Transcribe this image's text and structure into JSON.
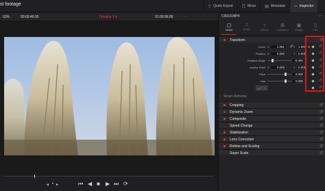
{
  "project_title": "st footage",
  "top_menu": [
    {
      "label": "Quick Export",
      "icon": "export-icon",
      "glyph": "⇪"
    },
    {
      "label": "Mixer",
      "icon": "mixer-icon",
      "glyph": "☷"
    },
    {
      "label": "Metadata",
      "icon": "metadata-icon",
      "glyph": "▤"
    },
    {
      "label": "Inspector",
      "icon": "inspector-icon",
      "glyph": "✂"
    }
  ],
  "viewer_header": {
    "zoom": "63%",
    "source_timecode": "00:00:46:30",
    "timeline_name": "Timeline 1 ▾",
    "record_timecode": "01:00:06;00",
    "options": "⋯"
  },
  "inspector": {
    "clip_name": "C0019.MP4",
    "menu": "⋯",
    "tabs": [
      {
        "label": "Video",
        "glyph": "▢",
        "active": true
      },
      {
        "label": "Audio",
        "glyph": "♫",
        "active": false
      },
      {
        "label": "Effects",
        "glyph": "✧",
        "active": false
      },
      {
        "label": "Transition",
        "glyph": "⊠",
        "active": false
      },
      {
        "label": "Image",
        "glyph": "▣",
        "active": false
      },
      {
        "label": "File",
        "glyph": "▯",
        "active": false
      }
    ],
    "transform": {
      "title": "Transform",
      "zoom": {
        "label": "Zoom",
        "x": "1.081",
        "y": "1.081"
      },
      "position": {
        "label": "Position",
        "x": "0.000",
        "y": "0.000"
      },
      "rotation": {
        "label": "Rotation Angle",
        "value": "-0.400"
      },
      "anchor": {
        "label": "Anchor Point",
        "x": "0.000",
        "y": "0.000"
      },
      "pitch": {
        "label": "Pitch",
        "value": "0.000"
      },
      "yaw": {
        "label": "Yaw",
        "value": "0.000"
      },
      "flip": {
        "label": "Flip",
        "h": "↔",
        "v": "↕"
      },
      "x_axis": "X",
      "y_axis": "Y"
    },
    "smart_reframe": "Smart Reframe",
    "sections": [
      {
        "label": "Cropping",
        "enabled": true
      },
      {
        "label": "Dynamic Zoom",
        "enabled": false
      },
      {
        "label": "Composite",
        "enabled": true
      },
      {
        "label": "Speed Change",
        "enabled": false
      },
      {
        "label": "Stabilization",
        "enabled": true
      },
      {
        "label": "Lens Correction",
        "enabled": true
      },
      {
        "label": "Retime and Scaling",
        "enabled": false
      },
      {
        "label": "Super Scale",
        "enabled": false
      }
    ],
    "reset_glyph": "↺"
  },
  "transport": {
    "loop": "⟲",
    "first": "⏮",
    "prev": "◀",
    "stop": "■",
    "play": "▶",
    "last": "⏭",
    "repeat": "⟳",
    "jog_prev": "◂",
    "jog_next": "▸",
    "jog_dot": "•"
  },
  "colors": {
    "accent": "#e33a2f",
    "highlight": "#e01515"
  }
}
